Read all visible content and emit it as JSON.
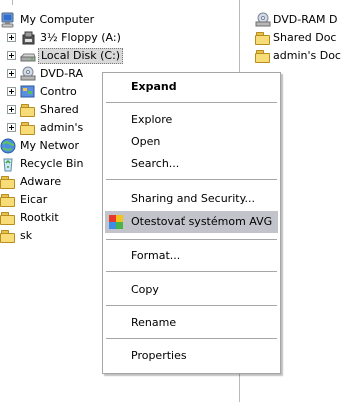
{
  "tree": {
    "items": [
      {
        "label": "My Computer",
        "icon": "computer-icon"
      },
      {
        "label": "3½ Floppy (A:)",
        "icon": "floppy-icon"
      },
      {
        "label": "Local Disk (C:)",
        "icon": "hard-disk-icon"
      },
      {
        "label": "DVD-RA",
        "icon": "dvd-drive-icon"
      },
      {
        "label": "Contro",
        "icon": "control-panel-icon"
      },
      {
        "label": "Shared",
        "icon": "folder-icon"
      },
      {
        "label": "admin's",
        "icon": "folder-icon"
      },
      {
        "label": "My Networ",
        "icon": "network-icon"
      },
      {
        "label": "Recycle Bin",
        "icon": "recycle-bin-icon"
      },
      {
        "label": "Adware",
        "icon": "folder-icon"
      },
      {
        "label": "Eicar",
        "icon": "folder-icon"
      },
      {
        "label": "Rootkit",
        "icon": "folder-icon"
      },
      {
        "label": "sk",
        "icon": "folder-icon"
      }
    ]
  },
  "list": {
    "items": [
      {
        "label": "DVD-RAM D",
        "icon": "dvd-drive-icon"
      },
      {
        "label": "Shared Doc",
        "icon": "folder-icon"
      },
      {
        "label": "admin's Doc",
        "icon": "folder-icon"
      }
    ]
  },
  "context_menu": {
    "items": [
      {
        "label": "Expand",
        "bold": true
      },
      {
        "label": "Explore"
      },
      {
        "label": "Open"
      },
      {
        "label": "Search..."
      },
      {
        "label": "Sharing and Security..."
      },
      {
        "label": "Otestovať systémom AVG",
        "highlighted": true,
        "icon": "avg-icon"
      },
      {
        "label": "Format..."
      },
      {
        "label": "Copy"
      },
      {
        "label": "Rename"
      },
      {
        "label": "Properties"
      }
    ]
  },
  "colors": {
    "menu_highlight": "#c3c3cc",
    "selected_item": "#d9d9d9",
    "folder_yellow": "#f7dc77"
  }
}
